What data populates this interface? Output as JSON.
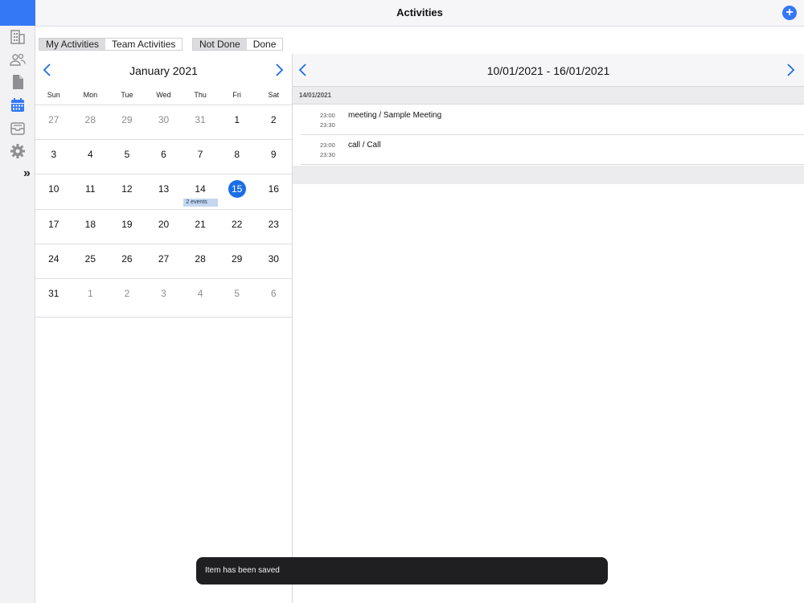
{
  "header": {
    "title": "Activities"
  },
  "sidebar": {
    "icons": [
      "building-icon",
      "people-icon",
      "document-icon",
      "calendar-icon",
      "inbox-icon",
      "gear-icon"
    ],
    "expand_label": "»",
    "active_color": "#3478f6"
  },
  "filters": {
    "owner": [
      "My Activities",
      "Team Activities"
    ],
    "status": [
      "Not Done",
      "Done"
    ]
  },
  "calendar": {
    "month_title": "January 2021",
    "days_of_week": [
      "Sun",
      "Mon",
      "Tue",
      "Wed",
      "Thu",
      "Fri",
      "Sat"
    ],
    "weeks": [
      [
        {
          "d": "27",
          "o": true
        },
        {
          "d": "28",
          "o": true
        },
        {
          "d": "29",
          "o": true
        },
        {
          "d": "30",
          "o": true
        },
        {
          "d": "31",
          "o": true
        },
        {
          "d": "1"
        },
        {
          "d": "2"
        }
      ],
      [
        {
          "d": "3"
        },
        {
          "d": "4"
        },
        {
          "d": "5"
        },
        {
          "d": "6"
        },
        {
          "d": "7"
        },
        {
          "d": "8"
        },
        {
          "d": "9"
        }
      ],
      [
        {
          "d": "10"
        },
        {
          "d": "11"
        },
        {
          "d": "12"
        },
        {
          "d": "13"
        },
        {
          "d": "14",
          "events": "2 events"
        },
        {
          "d": "15",
          "today": true
        },
        {
          "d": "16"
        }
      ],
      [
        {
          "d": "17"
        },
        {
          "d": "18"
        },
        {
          "d": "19"
        },
        {
          "d": "20"
        },
        {
          "d": "21"
        },
        {
          "d": "22"
        },
        {
          "d": "23"
        }
      ],
      [
        {
          "d": "24"
        },
        {
          "d": "25"
        },
        {
          "d": "26"
        },
        {
          "d": "27"
        },
        {
          "d": "28"
        },
        {
          "d": "29"
        },
        {
          "d": "30"
        }
      ],
      [
        {
          "d": "31"
        },
        {
          "d": "1",
          "o": true
        },
        {
          "d": "2",
          "o": true
        },
        {
          "d": "3",
          "o": true
        },
        {
          "d": "4",
          "o": true
        },
        {
          "d": "5",
          "o": true
        },
        {
          "d": "6",
          "o": true
        }
      ]
    ],
    "today_color": "#1a6fe8"
  },
  "agenda": {
    "range": "10/01/2021 - 16/01/2021",
    "date_header": "14/01/2021",
    "events": [
      {
        "start": "23:00",
        "end": "23:30",
        "label": "meeting / Sample Meeting"
      },
      {
        "start": "23:00",
        "end": "23:30",
        "label": "call / Call"
      }
    ]
  },
  "toast": {
    "message": "Item has been saved"
  }
}
